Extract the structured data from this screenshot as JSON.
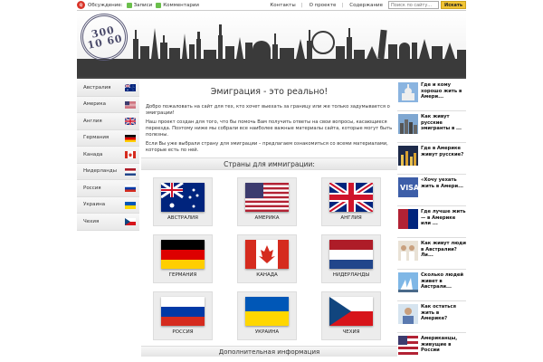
{
  "topbar": {
    "logo": "Q",
    "discussion_label": "Обсуждение:",
    "posts_label": "Записи",
    "comments_label": "Комментарии",
    "links": [
      "Контакты",
      "О проекте",
      "Содержание"
    ],
    "search_placeholder": "Поиск по сайту...",
    "search_button": "Искать"
  },
  "header": {
    "stamp_lines": [
      "300",
      "10 60"
    ]
  },
  "sidebar": {
    "items": [
      {
        "label": "Австралия",
        "flag": "au"
      },
      {
        "label": "Америка",
        "flag": "us"
      },
      {
        "label": "Англия",
        "flag": "gb"
      },
      {
        "label": "Германия",
        "flag": "de"
      },
      {
        "label": "Канада",
        "flag": "ca"
      },
      {
        "label": "Нидерланды",
        "flag": "nl"
      },
      {
        "label": "Россия",
        "flag": "ru"
      },
      {
        "label": "Украина",
        "flag": "ua"
      },
      {
        "label": "Чехия",
        "flag": "cz"
      }
    ]
  },
  "main": {
    "title": "Эмиграция - это реально!",
    "paragraphs": [
      "Добро пожаловать на сайт для тех, кто хочет выехать за границу или же только задумывается о эмиграции!",
      "Наш проект создан для того, что бы помочь Вам получить ответы на свои вопросы, касающиеся переезда. Поэтому ниже мы собрали все наиболее важные материалы сайта, которые могут быть полезны.",
      "Если Вы уже выбрали страну для эмиграции – предлагаем ознакомиться со всеми материалами, которые есть по ней."
    ],
    "countries_heading": "Страны для иммиграции:",
    "countries": [
      {
        "label": "АВСТРАЛИЯ",
        "flag": "au"
      },
      {
        "label": "АМЕРИКА",
        "flag": "us"
      },
      {
        "label": "АНГЛИЯ",
        "flag": "gb"
      },
      {
        "label": "ГЕРМАНИЯ",
        "flag": "de"
      },
      {
        "label": "КАНАДА",
        "flag": "ca"
      },
      {
        "label": "НИДЕРЛАНДЫ",
        "flag": "nl"
      },
      {
        "label": "РОССИЯ",
        "flag": "ru"
      },
      {
        "label": "УКРАИНА",
        "flag": "ua"
      },
      {
        "label": "ЧЕХИЯ",
        "flag": "cz"
      }
    ],
    "bottom_heading": "Дополнительная информация"
  },
  "right": {
    "items": [
      {
        "text": "Где и кому хорошо жить в Амери...",
        "thumb": "capitol"
      },
      {
        "text": "Как живут русские эмигранты в ...",
        "thumb": "city"
      },
      {
        "text": "Где в Америке живут русские?",
        "thumb": "night"
      },
      {
        "text": "«Хочу уехать жить в Амери...",
        "thumb": "visa"
      },
      {
        "text": "Где лучше жить — в Америке или ...",
        "thumb": "vs"
      },
      {
        "text": "Как живут люди в Австралии? Ли...",
        "thumb": "people"
      },
      {
        "text": "Сколько людей живет в Австрали...",
        "thumb": "opera"
      },
      {
        "text": "Как остаться жить в Америке?",
        "thumb": "person"
      },
      {
        "text": "Американцы, живущие в России",
        "thumb": "usflag"
      }
    ]
  },
  "colors": {
    "accent": "#f2c433",
    "header_rule": "#444444",
    "logo": "#d9352a"
  }
}
